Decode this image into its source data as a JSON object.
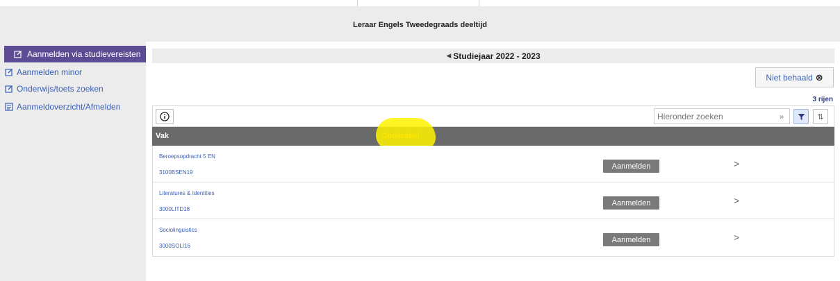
{
  "header": {
    "title": "Leraar Engels Tweedegraads deeltijd"
  },
  "sidebar": {
    "items": [
      {
        "label": "Aanmelden via studievereisten",
        "icon": "edit-icon",
        "active": true
      },
      {
        "label": "Aanmelden minor",
        "icon": "edit-icon"
      },
      {
        "label": "Onderwijs/toets zoeken",
        "icon": "edit-icon"
      },
      {
        "label": "Aanmeldoverzicht/Afmelden",
        "icon": "list-icon"
      }
    ]
  },
  "main": {
    "year": "Studiejaar 2022 - 2023",
    "filter_chip": "Niet behaald",
    "row_count": "3 rijen",
    "search": {
      "placeholder": "Hieronder zoeken",
      "go": "»"
    },
    "columns": [
      "Vak",
      "Onderdeel"
    ],
    "rows": [
      {
        "name": "Beroepsopdracht 5 EN",
        "code": "3100BSEN19",
        "action": "Aanmelden"
      },
      {
        "name": "Literatures & Identities",
        "code": "3000LITD18",
        "action": "Aanmelden"
      },
      {
        "name": "Sociolinguistics",
        "code": "3000SOLI16",
        "action": "Aanmelden"
      }
    ]
  },
  "colors": {
    "accent": "#5d4c94",
    "link": "#3a5fb5",
    "table_header": "#6a6a6a",
    "highlight": "#fff200"
  }
}
